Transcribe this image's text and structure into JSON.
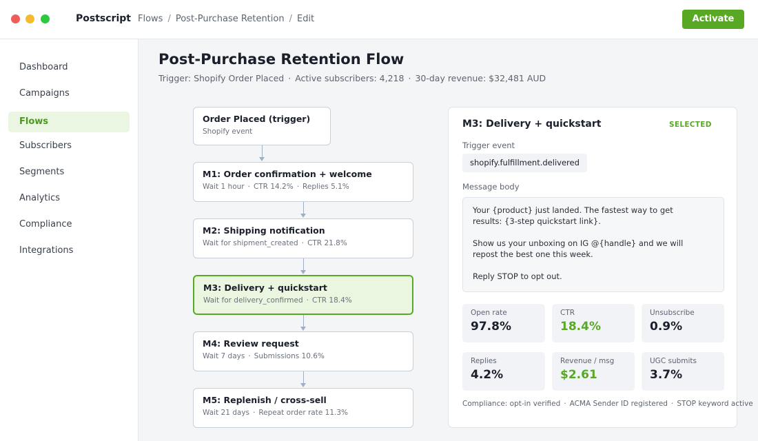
{
  "app": {
    "name": "Postscript",
    "breadcrumbs": [
      "Flows",
      "Post-Purchase Retention",
      "Edit"
    ],
    "breadcrumb_separator": "/",
    "activate_label": "Activate"
  },
  "sidebar": {
    "items": [
      {
        "label": "Dashboard",
        "active": false
      },
      {
        "label": "Campaigns",
        "active": false
      },
      {
        "label": "Flows",
        "active": true
      },
      {
        "label": "Subscribers",
        "active": false
      },
      {
        "label": "Segments",
        "active": false
      },
      {
        "label": "Analytics",
        "active": false
      },
      {
        "label": "Compliance",
        "active": false
      },
      {
        "label": "Integrations",
        "active": false
      }
    ]
  },
  "header": {
    "title": "Post-Purchase Retention Flow",
    "trigger": "Trigger: Shopify Order Placed",
    "subscribers": "Active subscribers: 4,218",
    "revenue": "30-day revenue: $32,481 AUD"
  },
  "flow": {
    "nodes": [
      {
        "title": "Order Placed (trigger)",
        "meta": [
          "Shopify event"
        ]
      },
      {
        "title": "M1: Order confirmation + welcome",
        "meta": [
          "Wait 1 hour",
          "CTR 14.2%",
          "Replies 5.1%"
        ]
      },
      {
        "title": "M2: Shipping notification",
        "meta": [
          "Wait for shipment_created",
          "CTR 21.8%"
        ]
      },
      {
        "title": "M3: Delivery + quickstart",
        "meta": [
          "Wait for delivery_confirmed",
          "CTR 18.4%"
        ],
        "selected": true
      },
      {
        "title": "M4: Review request",
        "meta": [
          "Wait 7 days",
          "Submissions 10.6%"
        ]
      },
      {
        "title": "M5: Replenish / cross-sell",
        "meta": [
          "Wait 21 days",
          "Repeat order rate 11.3%"
        ]
      }
    ]
  },
  "detail": {
    "title": "M3: Delivery + quickstart",
    "badge": "SELECTED",
    "trigger_label": "Trigger event",
    "trigger_value": "shopify.fulfillment.delivered",
    "body_label": "Message body",
    "body_lines": [
      "Your {product} just landed. The fastest way to get",
      "results: {3-step quickstart link}.",
      "",
      "Show us your unboxing on IG @{handle} and we will",
      "repost the best one this week.",
      "",
      "Reply STOP to opt out."
    ],
    "stats": [
      {
        "label": "Open rate",
        "value": "97.8%",
        "highlight": false
      },
      {
        "label": "CTR",
        "value": "18.4%",
        "highlight": true
      },
      {
        "label": "Unsubscribe",
        "value": "0.9%",
        "highlight": false
      },
      {
        "label": "Replies",
        "value": "4.2%",
        "highlight": false
      },
      {
        "label": "Revenue / msg",
        "value": "$2.61",
        "highlight": true
      },
      {
        "label": "UGC submits",
        "value": "3.7%",
        "highlight": false
      }
    ],
    "compliance": [
      "Compliance: opt-in verified",
      "ACMA Sender ID registered",
      "STOP keyword active"
    ]
  },
  "colors": {
    "accent": "#58a824",
    "selected_bg": "#eaf6e0",
    "node_border": "#c9cfd8",
    "connector": "#9fb0c4"
  }
}
